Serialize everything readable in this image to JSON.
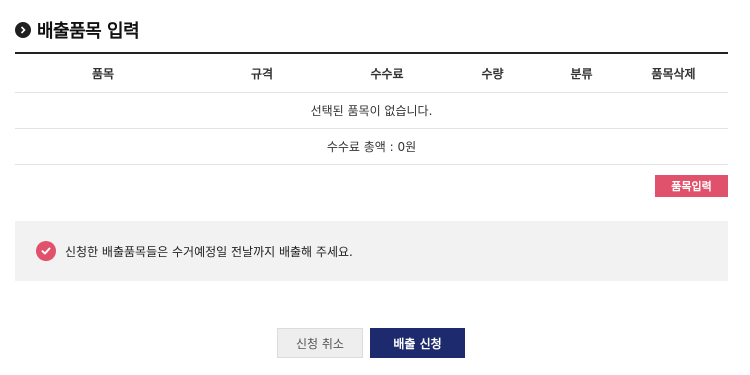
{
  "page": {
    "title": "배출품목 입력",
    "title_icon": "arrow-circle-icon"
  },
  "table": {
    "headers": [
      "품목",
      "규격",
      "수수료",
      "수량",
      "분류",
      "품목삭제"
    ],
    "empty_message": "선택된 품목이 없습니다.",
    "total_label": "수수료 총액 : 0원"
  },
  "buttons": {
    "add_item": "품목입력",
    "cancel": "신청 취소",
    "submit": "배출 신청"
  },
  "notice": {
    "text": "신청한 배출품목들은 수거예정일 전날까지 배출해 주세요.",
    "icon": "check-circle-icon"
  },
  "colors": {
    "accent": "#e0516b",
    "primary": "#1d2a6e",
    "notice_bg": "#f2f2f2"
  }
}
